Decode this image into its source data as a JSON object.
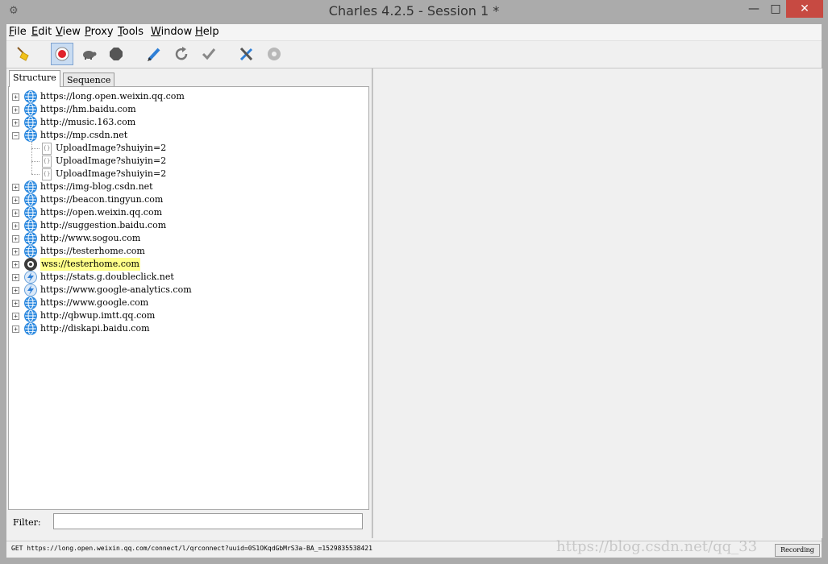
{
  "window": {
    "title": "Charles 4.2.5 - Session 1 *",
    "minimize_glyph": "—",
    "maximize_glyph": "□",
    "close_glyph": "✕"
  },
  "menu": [
    {
      "label": "File",
      "accel": "F",
      "rest": "ile"
    },
    {
      "label": "Edit",
      "accel": "E",
      "rest": "dit"
    },
    {
      "label": "View",
      "accel": "V",
      "rest": "iew"
    },
    {
      "label": "Proxy",
      "accel": "P",
      "rest": "roxy"
    },
    {
      "label": "Tools",
      "accel": "T",
      "rest": "ools"
    },
    {
      "label": "Window",
      "accel": "W",
      "rest": "indow"
    },
    {
      "label": "Help",
      "accel": "H",
      "rest": "elp"
    }
  ],
  "toolbar": {
    "icons": [
      "broom-icon",
      "record-icon",
      "throttle-turtle-icon",
      "breakpoint-stop-icon",
      "compose-pen-icon",
      "repeat-icon",
      "validate-check-icon",
      "tools-icon",
      "settings-gear-icon"
    ],
    "recording_active": true
  },
  "tabs": {
    "structure": "Structure",
    "sequence": "Sequence"
  },
  "tree": [
    {
      "label": "https://long.open.weixin.qq.com",
      "icon": "globe-icon",
      "expanded": false,
      "level": 0
    },
    {
      "label": "https://hm.baidu.com",
      "icon": "globe-icon",
      "expanded": false,
      "level": 0
    },
    {
      "label": "http://music.163.com",
      "icon": "globe-icon",
      "expanded": false,
      "level": 0
    },
    {
      "label": "https://mp.csdn.net",
      "icon": "globe-icon",
      "expanded": true,
      "level": 0
    },
    {
      "label": "UploadImage?shuiyin=2",
      "icon": "document-icon",
      "level": 1
    },
    {
      "label": "UploadImage?shuiyin=2",
      "icon": "document-icon",
      "level": 1
    },
    {
      "label": "UploadImage?shuiyin=2",
      "icon": "document-icon",
      "level": 1
    },
    {
      "label": "https://img-blog.csdn.net",
      "icon": "globe-icon",
      "expanded": false,
      "level": 0
    },
    {
      "label": "https://beacon.tingyun.com",
      "icon": "globe-icon",
      "expanded": false,
      "level": 0
    },
    {
      "label": "https://open.weixin.qq.com",
      "icon": "globe-icon",
      "expanded": false,
      "level": 0
    },
    {
      "label": "http://suggestion.baidu.com",
      "icon": "globe-icon",
      "expanded": false,
      "level": 0
    },
    {
      "label": "http://www.sogou.com",
      "icon": "globe-icon",
      "expanded": false,
      "level": 0
    },
    {
      "label": "https://testerhome.com",
      "icon": "globe-icon",
      "expanded": false,
      "level": 0
    },
    {
      "label": "wss://testerhome.com",
      "icon": "websocket-icon",
      "expanded": false,
      "level": 0,
      "highlighted": true
    },
    {
      "label": "https://stats.g.doubleclick.net",
      "icon": "lightning-icon",
      "expanded": false,
      "level": 0
    },
    {
      "label": "https://www.google-analytics.com",
      "icon": "lightning-icon",
      "expanded": false,
      "level": 0
    },
    {
      "label": "https://www.google.com",
      "icon": "globe-icon",
      "expanded": false,
      "level": 0
    },
    {
      "label": "http://qbwup.imtt.qq.com",
      "icon": "globe-icon",
      "expanded": false,
      "level": 0
    },
    {
      "label": "http://diskapi.baidu.com",
      "icon": "globe-icon",
      "expanded": false,
      "level": 0
    }
  ],
  "filter": {
    "label": "Filter:",
    "value": ""
  },
  "status": {
    "text": "GET https://long.open.weixin.qq.com/connect/l/qrconnect?uuid=0S1OKqdGbMrS3a-BA_=1529835538421",
    "recording_label": "Recording"
  },
  "watermark": "https://blog.csdn.net/qq_33"
}
